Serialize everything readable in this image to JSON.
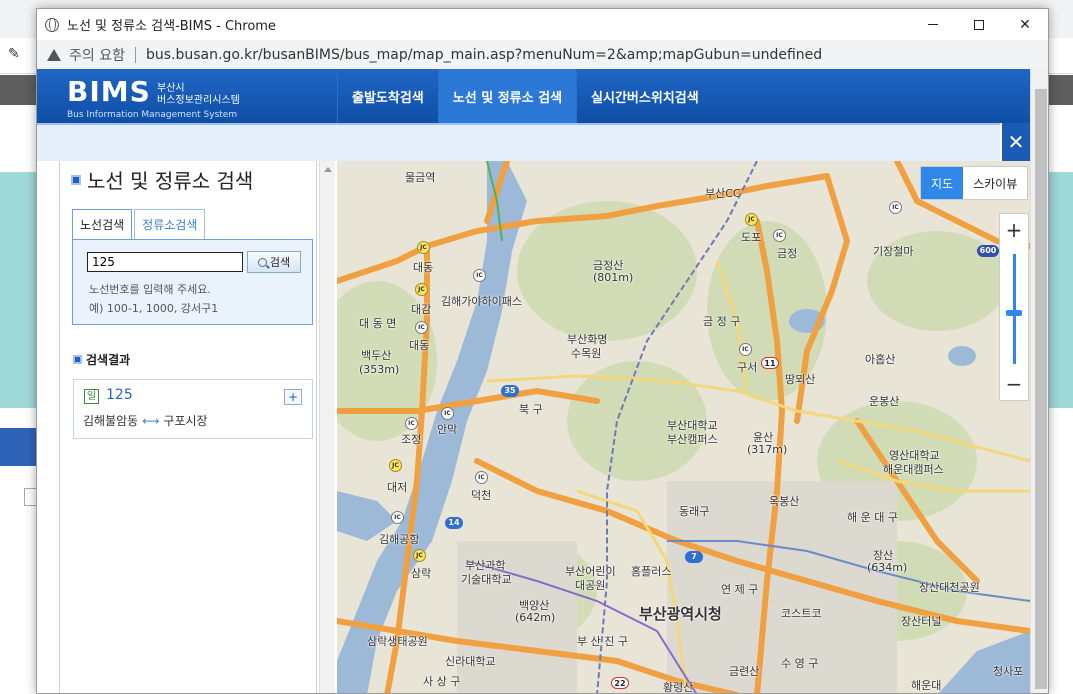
{
  "window": {
    "title": "노선 및 정류소 검색-BIMS - Chrome",
    "security_label": "주의 요함",
    "url": "bus.busan.go.kr/busanBIMS/bus_map/map_main.asp?menuNum=2&amp;mapGubun=undefined"
  },
  "header": {
    "logo": "BIMS",
    "logo_sub1": "부산시",
    "logo_sub2": "버스정보관리시스템",
    "logo_eng": "Bus Information Management System",
    "nav": [
      {
        "label": "출발도착검색"
      },
      {
        "label": "노선 및 정류소 검색"
      },
      {
        "label": "실시간버스위치검색"
      }
    ]
  },
  "panel": {
    "title": "노선 및 정류소 검색",
    "tabs": [
      {
        "label": "노선검색"
      },
      {
        "label": "정류소검색"
      }
    ],
    "search_value": "125",
    "search_button": "검색",
    "help1": "노선번호를 입력해 주세요.",
    "help2": "예) 100-1, 1000, 강서구1",
    "results_title": "검색결과",
    "result": {
      "badge": "일",
      "number": "125",
      "from": "김해불암동",
      "to": "구포시장",
      "expand": "+"
    }
  },
  "map": {
    "toggle": [
      {
        "label": "지도"
      },
      {
        "label": "스카이뷰"
      }
    ],
    "zoom_in": "+",
    "zoom_out": "−",
    "labels": {
      "l1": "물금역",
      "l2": "부산CC",
      "l3": "도포",
      "l4": "금정",
      "l5": "기장철마",
      "l6": "대동",
      "l7": "금정산",
      "l8": "(801m)",
      "l9": "김해가야하이패스",
      "l10": "대 동 면",
      "l11": "대감",
      "l12": "금 정 구",
      "l13": "아홉산",
      "l14": "백두산",
      "l15": "(353m)",
      "l16": "대동",
      "l17": "부산화명",
      "l18": "수목원",
      "l19": "구서",
      "l20": "땅뫼산",
      "l21": "운봉산",
      "l22": "북 구",
      "l23": "부산대학교",
      "l24": "부산캠퍼스",
      "l25": "윤산",
      "l26": "(317m)",
      "l27": "조정",
      "l28": "안막",
      "l29": "영산대학교",
      "l30": "해운대캠퍼스",
      "l31": "대저",
      "l32": "덕천",
      "l33": "동래구",
      "l34": "옥봉산",
      "l35": "해 운 대 구",
      "l36": "김해공항",
      "l37": "장산",
      "l38": "(634m)",
      "l39": "부산과학",
      "l40": "기술대학교",
      "l41": "부산어린이",
      "l42": "대공원",
      "l43": "홈플러스",
      "l44": "연 제 구",
      "l45": "장산대천공원",
      "l46": "삼락",
      "l47": "백양산",
      "l48": "(642m)",
      "l49": "부산광역시청",
      "l50": "코스트코",
      "l51": "장산터널",
      "l52": "삼락생태공원",
      "l53": "부 산 진 구",
      "l54": "신라대학교",
      "l55": "금련산",
      "l56": "수 영 구",
      "l57": "청사포",
      "l58": "사 상 구",
      "l59": "황령산",
      "l60": "해운대"
    },
    "shields": {
      "s35": "35",
      "s14": "14",
      "s7": "7",
      "s11": "11",
      "s22": "22",
      "s600": "600"
    },
    "jc": "JC",
    "ic": "IC"
  },
  "colors": {
    "header_blue": "#1f66c5",
    "active_tab_blue": "#2f87e8",
    "road_orange": "#f0a040",
    "river_blue": "#9cb9d8"
  }
}
